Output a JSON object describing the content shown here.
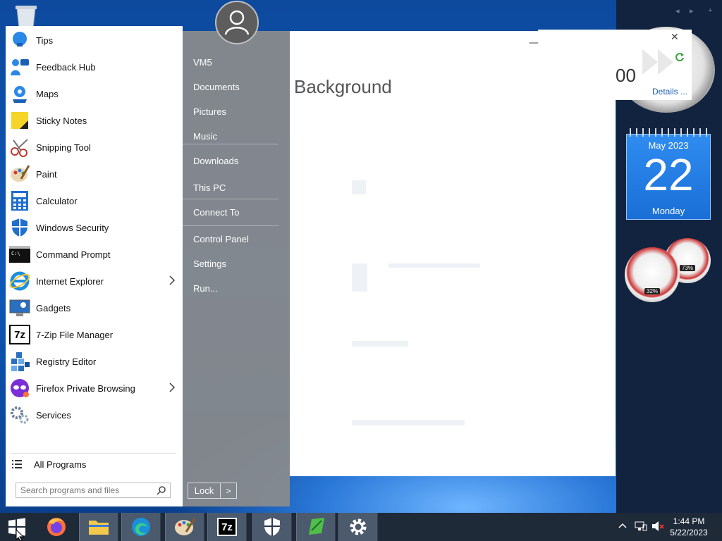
{
  "start_menu": {
    "programs": [
      {
        "label": "Tips",
        "icon": "lightbulb-icon",
        "arrow": false
      },
      {
        "label": "Feedback Hub",
        "icon": "feedback-hub-icon",
        "arrow": false
      },
      {
        "label": "Maps",
        "icon": "maps-icon",
        "arrow": false
      },
      {
        "label": "Sticky Notes",
        "icon": "sticky-notes-icon",
        "arrow": false
      },
      {
        "label": "Snipping Tool",
        "icon": "scissors-icon",
        "arrow": false
      },
      {
        "label": "Paint",
        "icon": "palette-icon",
        "arrow": false
      },
      {
        "label": "Calculator",
        "icon": "calculator-icon",
        "arrow": false
      },
      {
        "label": "Windows Security",
        "icon": "shield-icon",
        "arrow": false
      },
      {
        "label": "Command Prompt",
        "icon": "terminal-icon",
        "arrow": false
      },
      {
        "label": "Internet Explorer",
        "icon": "ie-icon",
        "arrow": true
      },
      {
        "label": "Gadgets",
        "icon": "gadgets-icon",
        "arrow": false
      },
      {
        "label": "7-Zip File Manager",
        "icon": "7zip-icon",
        "arrow": false
      },
      {
        "label": "Registry Editor",
        "icon": "registry-icon",
        "arrow": false
      },
      {
        "label": "Firefox Private Browsing",
        "icon": "firefox-private-icon",
        "arrow": true
      },
      {
        "label": "Services",
        "icon": "gears-icon",
        "arrow": false
      }
    ],
    "all_programs": "All Programs",
    "search_placeholder": "Search programs and files",
    "right_links": [
      {
        "label": "VM5"
      },
      {
        "label": "Documents"
      },
      {
        "label": "Pictures"
      },
      {
        "label": "Music"
      },
      {
        "label": "Downloads"
      },
      {
        "label": "This PC"
      },
      {
        "label": "Connect To"
      },
      {
        "label": "Control Panel"
      },
      {
        "label": "Settings"
      },
      {
        "label": "Run..."
      }
    ],
    "lock_label": "Lock",
    "lock_arrow": ">"
  },
  "settings_window": {
    "title": "Background",
    "minimize": "—",
    "maximize": "☐",
    "close": "✕"
  },
  "popup": {
    "number": "00",
    "details": "Details ...",
    "close": "✕"
  },
  "calendar": {
    "month": "May 2023",
    "day": "22",
    "weekday": "Monday"
  },
  "meters": {
    "cpu": "32%",
    "memory": "73%"
  },
  "taskbar": {
    "time": "1:44 PM",
    "date": "5/22/2023",
    "seven_zip": "7z"
  },
  "nav": {
    "back": "◂",
    "forward": "▸",
    "add": "+"
  }
}
